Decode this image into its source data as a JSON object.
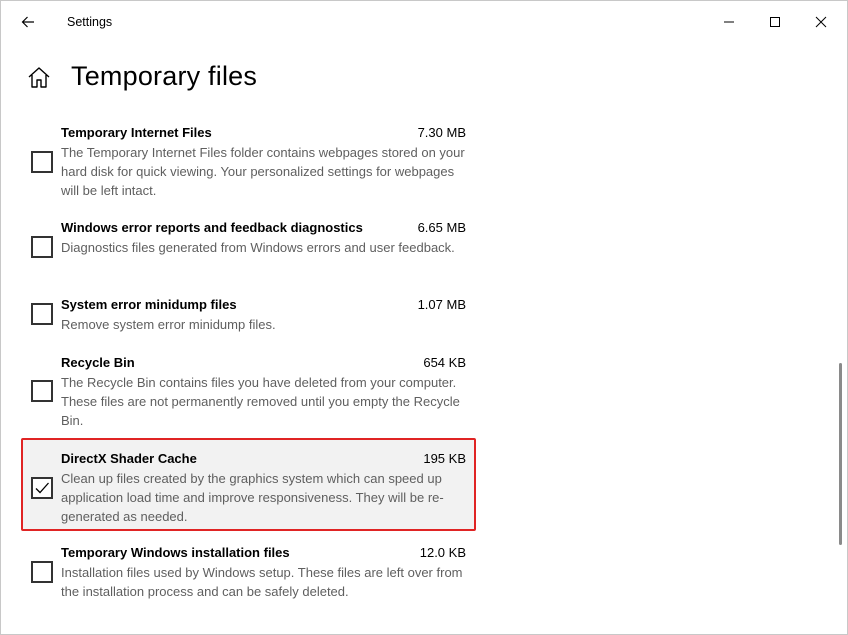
{
  "window": {
    "title": "Settings"
  },
  "page": {
    "title": "Temporary files"
  },
  "items": [
    {
      "name": "Temporary Internet Files",
      "size": "7.30 MB",
      "description": "The Temporary Internet Files folder contains webpages stored on your hard disk for quick viewing. Your personalized settings for webpages will be left intact.",
      "checked": false
    },
    {
      "name": "Windows error reports and feedback diagnostics",
      "size": "6.65 MB",
      "description": "Diagnostics files generated from Windows errors and user feedback.",
      "checked": false
    },
    {
      "name": "System error minidump files",
      "size": "1.07 MB",
      "description": "Remove system error minidump files.",
      "checked": false
    },
    {
      "name": "Recycle Bin",
      "size": "654 KB",
      "description": "The Recycle Bin contains files you have deleted from your computer. These files are not permanently removed until you empty the Recycle Bin.",
      "checked": false
    },
    {
      "name": "DirectX Shader Cache",
      "size": "195 KB",
      "description": "Clean up files created by the graphics system which can speed up application load time and improve responsiveness. They will be re-generated as needed.",
      "checked": true
    },
    {
      "name": "Temporary Windows installation files",
      "size": "12.0 KB",
      "description": "Installation files used by Windows setup.  These files are left over from the installation process and can be safely deleted.",
      "checked": false
    }
  ],
  "colors": {
    "highlight_border": "#e02424",
    "selected_background": "#f2f2f2",
    "description_text": "#5f5f5f"
  },
  "icons": {
    "back": "back-arrow-icon",
    "minimize": "minimize-icon",
    "maximize": "maximize-icon",
    "close": "close-icon",
    "home": "home-icon",
    "check": "checkmark-icon"
  }
}
